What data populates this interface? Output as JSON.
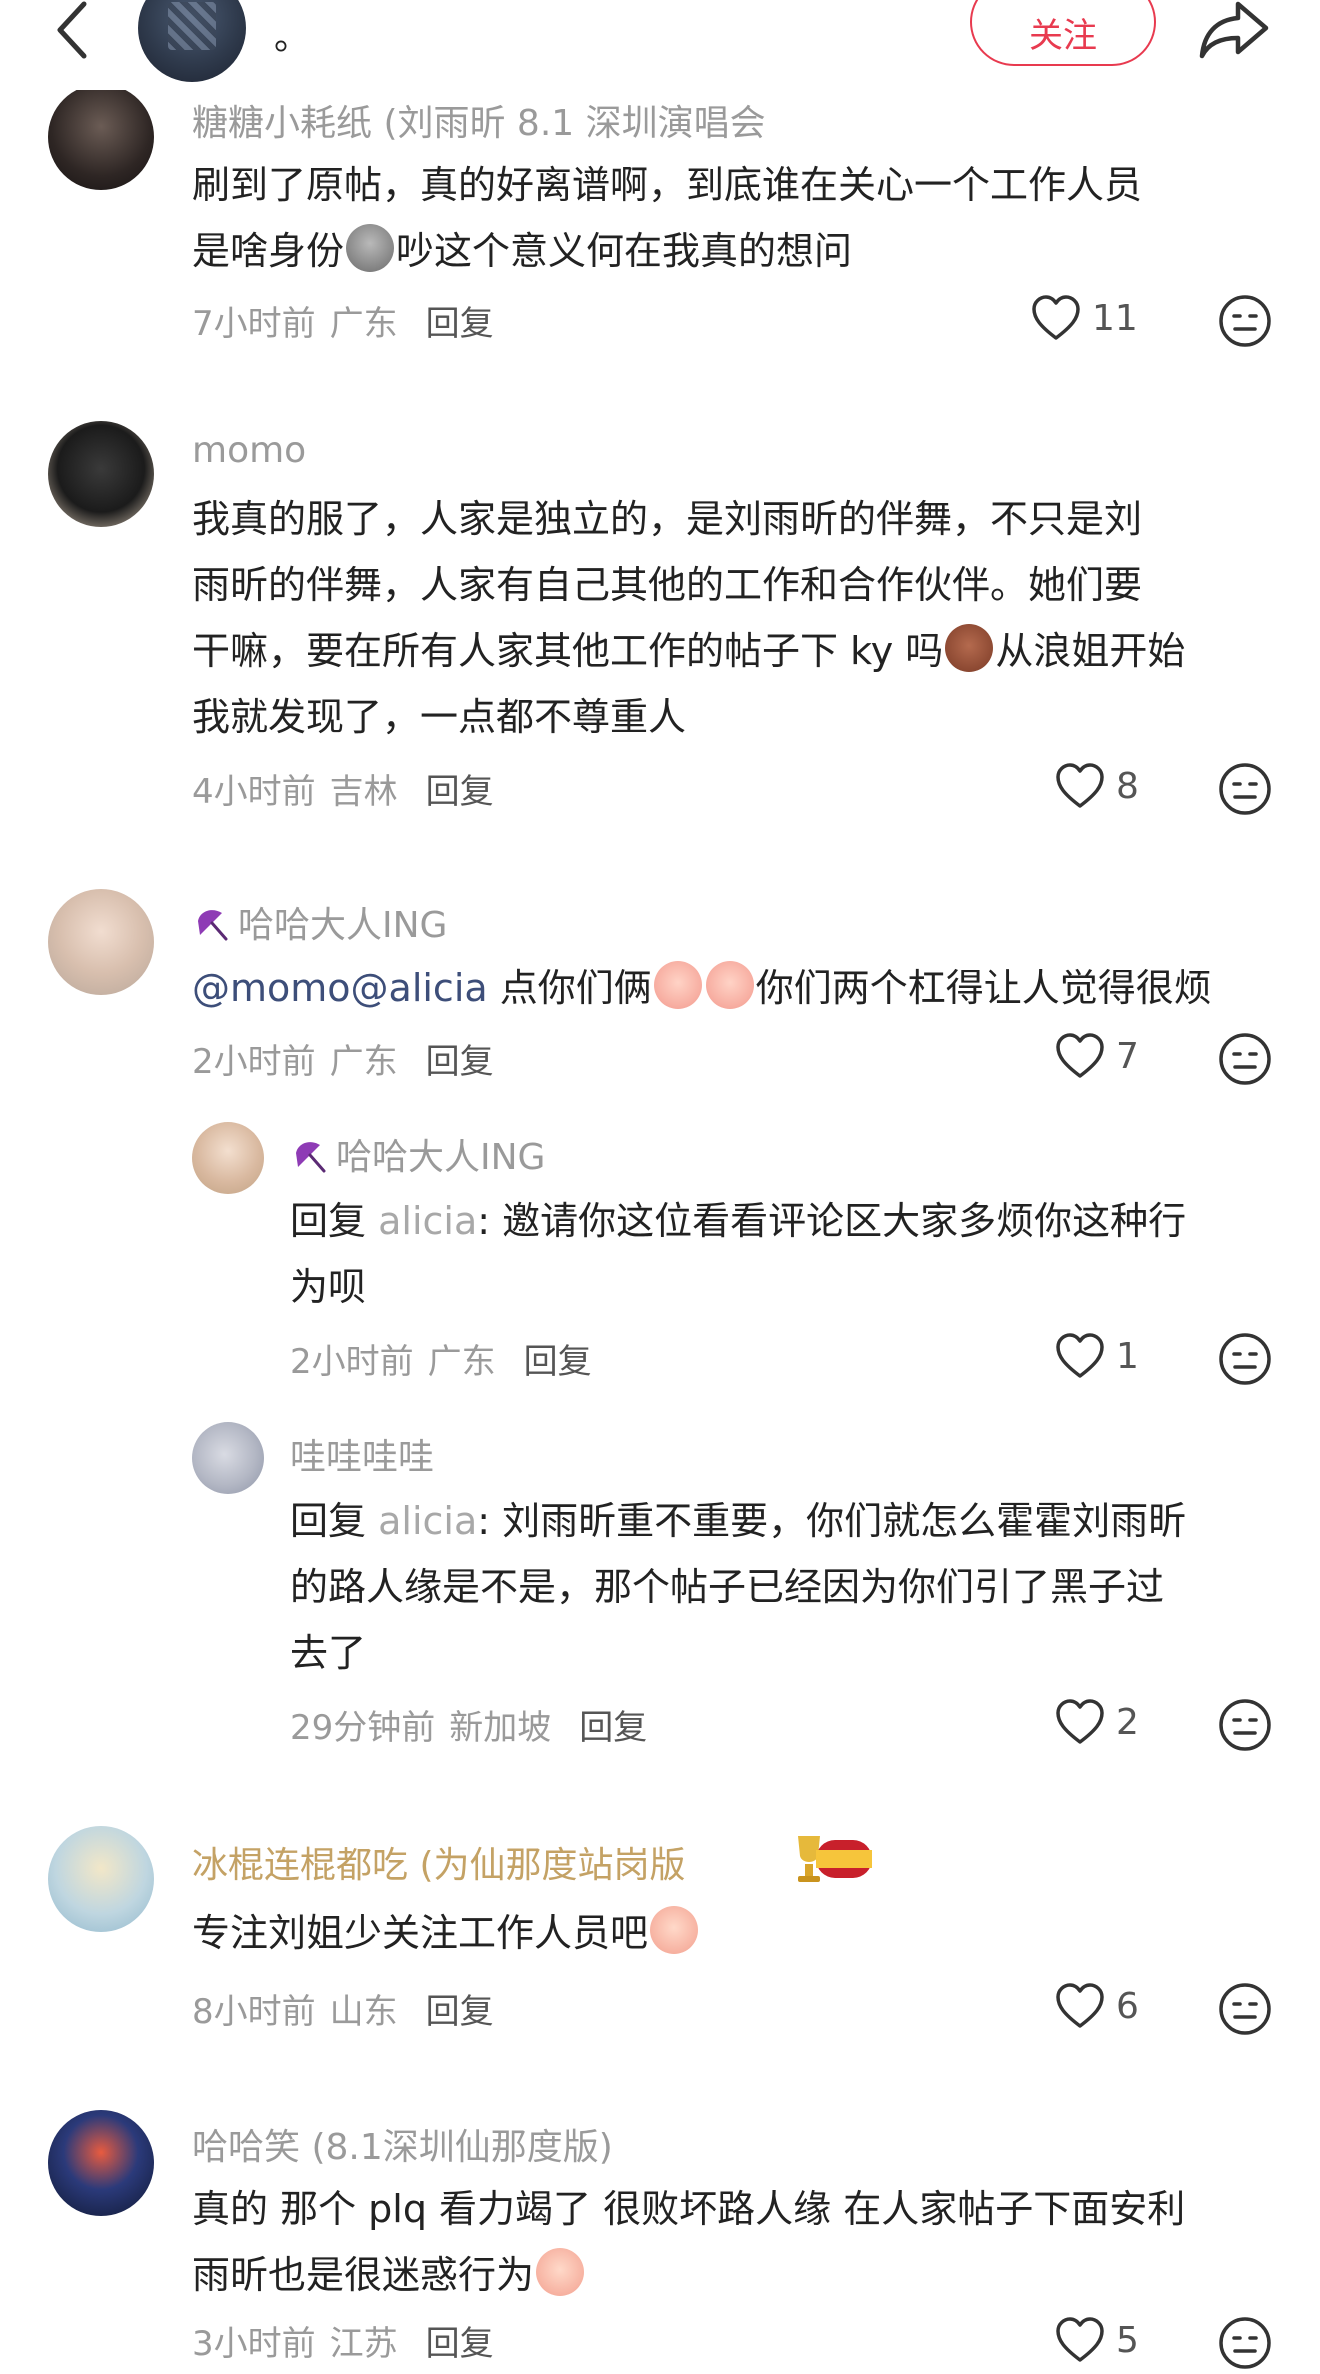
{
  "header": {
    "user_name": "。",
    "follow_label": "关注"
  },
  "comments": [
    {
      "name": "糖糖小耗纸 (刘雨昕 8.1 深圳演唱会",
      "text_line1": "刷到了原帖，真的好离谱啊，到底谁在关心一个工作人员",
      "text_line2_a": "是啥身份",
      "text_line2_b": "吵这个意义何在我真的想问",
      "time": "7小时前",
      "region": "广东",
      "reply": "回复",
      "likes": "11"
    },
    {
      "name": "momo",
      "text_line1": "我真的服了，人家是独立的，是刘雨昕的伴舞，不只是刘",
      "text_line2": "雨昕的伴舞，人家有自己其他的工作和合作伙伴。她们要",
      "text_line3_a": "干嘛，要在所有人家其他工作的帖子下 ky 吗",
      "text_line3_b": "从浪姐开始",
      "text_line4": "我就发现了，一点都不尊重人",
      "time": "4小时前",
      "region": "吉林",
      "reply": "回复",
      "likes": "8"
    },
    {
      "name": "哈哈大人ING",
      "mention": "@momo@alicia",
      "text_a": " 点你们俩",
      "text_b": "你们两个杠得让人觉得很烦",
      "time": "2小时前",
      "region": "广东",
      "reply": "回复",
      "likes": "7"
    },
    {
      "name": "哈哈大人ING",
      "reply_prefix": "回复 ",
      "reply_to": "alicia",
      "text_line1": ": 邀请你这位看看评论区大家多烦你这种行",
      "text_line2": "为呗",
      "time": "2小时前",
      "region": "广东",
      "reply": "回复",
      "likes": "1"
    },
    {
      "name": "哇哇哇哇",
      "reply_prefix": "回复 ",
      "reply_to": "alicia",
      "text_line1": ": 刘雨昕重不重要，你们就怎么霍霍刘雨昕",
      "text_line2": "的路人缘是不是，那个帖子已经因为你们引了黑子过",
      "text_line3": "去了",
      "time": "29分钟前",
      "region": "新加坡",
      "reply": "回复",
      "likes": "2"
    },
    {
      "name": "冰棍连棍都吃 (为仙那度站岗版",
      "text": "专注刘姐少关注工作人员吧",
      "time": "8小时前",
      "region": "山东",
      "reply": "回复",
      "likes": "6"
    },
    {
      "name": "哈哈笑 (8.1深圳仙那度版)",
      "text_line1": "真的 那个 plq 看力竭了 很败坏路人缘 在人家帖子下面安利",
      "text_line2": "雨昕也是很迷惑行为",
      "time": "3小时前",
      "region": "江苏",
      "reply": "回复",
      "likes": "5"
    }
  ],
  "colors": {
    "accent": "#e83a4f",
    "mention": "#3d4e79",
    "gold_name": "#c4a265",
    "meta_gray": "#9a9a9a"
  }
}
